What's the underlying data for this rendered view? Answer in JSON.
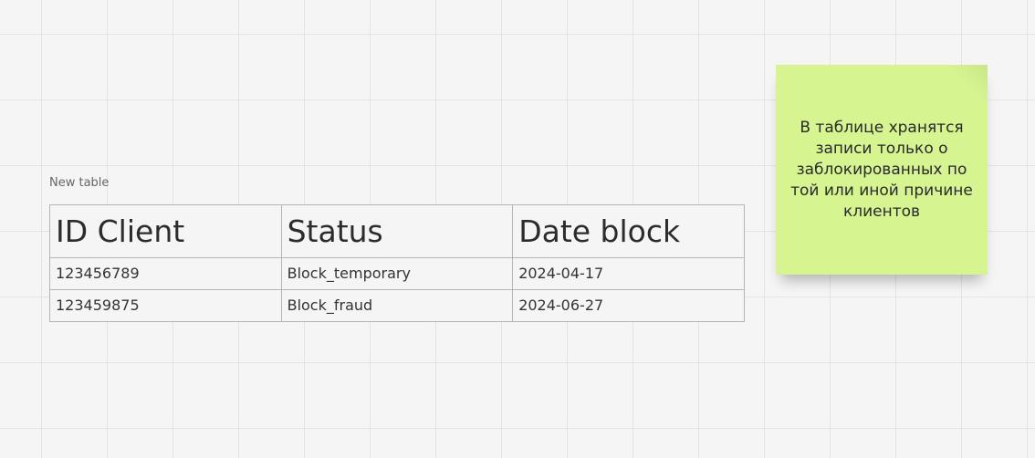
{
  "board": {
    "table": {
      "caption": "New table",
      "headers": [
        "ID Client",
        "Status",
        "Date block"
      ],
      "rows": [
        [
          "123456789",
          "Block_temporary",
          "2024-04-17"
        ],
        [
          "123459875",
          "Block_fraud",
          "2024-06-27"
        ]
      ]
    },
    "sticky_note": {
      "text": "В таблице хранятся записи только о заблокированных по той или иной причине клиентов",
      "color": "#d6f591"
    }
  }
}
